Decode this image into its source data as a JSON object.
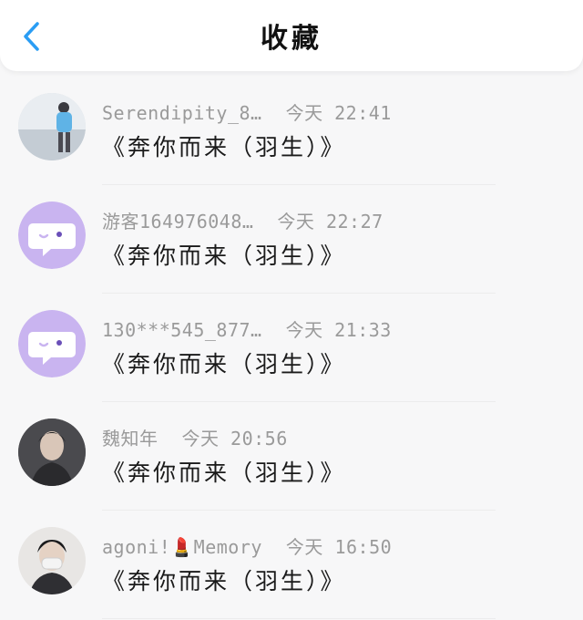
{
  "header": {
    "title": "收藏"
  },
  "favorites": [
    {
      "username": "Serendipity_8…",
      "time": "今天 22:41",
      "title": "《奔你而来（羽生）》",
      "avatar": "photo-person-hoodie"
    },
    {
      "username": "游客164976048…",
      "time": "今天 22:27",
      "title": "《奔你而来（羽生）》",
      "avatar": "purple-chat-bubble-icon"
    },
    {
      "username": "130***545_877…",
      "time": "今天 21:33",
      "title": "《奔你而来（羽生）》",
      "avatar": "purple-chat-bubble-icon"
    },
    {
      "username": "魏知年",
      "time": "今天 20:56",
      "title": "《奔你而来（羽生）》",
      "avatar": "photo-person-dark"
    },
    {
      "username": "agoni!💄Memory",
      "time": "今天 16:50",
      "title": "《奔你而来（羽生）》",
      "avatar": "photo-person-mask"
    }
  ],
  "colors": {
    "accent": "#2a9df4",
    "avatar_purple": "#c9b4f0",
    "meta_gray": "#9a9a9a"
  }
}
